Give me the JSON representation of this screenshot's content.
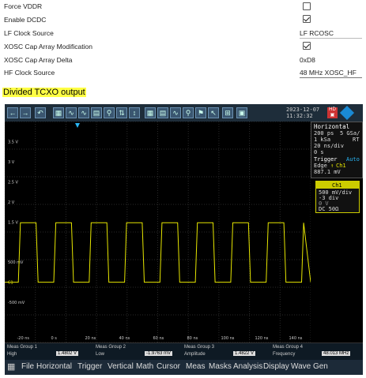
{
  "settings": {
    "force_vddr": {
      "label": "Force VDDR",
      "checked": false
    },
    "enable_dcdc": {
      "label": "Enable DCDC",
      "checked": true
    },
    "lf_clock": {
      "label": "LF Clock Source",
      "value": "LF RCOSC"
    },
    "xosc_cap_mod": {
      "label": "XOSC Cap Array Modification",
      "checked": true
    },
    "xosc_cap_delta": {
      "label": "XOSC Cap Array Delta",
      "value": "0xD8"
    },
    "hf_clock": {
      "label": "HF Clock Source",
      "value": "48 MHz XOSC_HF"
    }
  },
  "heading": "Divided TCXO output",
  "scope": {
    "datetime": {
      "date": "2023-12-07",
      "time": "11:32:32"
    },
    "horizontal": {
      "title": "Horizontal",
      "line1": "200 ps",
      "rate": "5 GSa/",
      "line2": "1 kSa",
      "rt": "RT",
      "div": "20 ns/div",
      "offset": "0 s"
    },
    "trigger": {
      "title": "Trigger",
      "mode": "Auto",
      "edge": "Edge",
      "src": "Ch1",
      "level": "887.1 mV"
    },
    "ch1": {
      "title": "Ch1",
      "scale": "500 mV/div",
      "offset": "-3 div",
      "volt": "0 V",
      "coupling": "DC 50Ω"
    },
    "y_labels": [
      "3.5 V",
      "3 V",
      "2.5 V",
      "2 V",
      "1.5 V",
      "500 mV",
      "C1",
      "-500 mV"
    ],
    "x_labels": [
      "-20 ns",
      "0 s",
      "20 ns",
      "40 ns",
      "60 ns",
      "80 ns",
      "100 ns",
      "120 ns",
      "140 ns"
    ],
    "meas": {
      "groups": [
        "Meas Group 1",
        "Meas Group 2",
        "Meas Group 3",
        "Meas Group 4"
      ],
      "names": [
        "High",
        "Low",
        "Amplitude",
        "Frequency"
      ],
      "values": [
        "1.4802 V",
        "-1.9763 mV",
        "1.4822 V",
        "48.013 MHz"
      ]
    },
    "menu": [
      "File",
      "Horizontal",
      "Trigger",
      "Vertical",
      "Math",
      "Cursor",
      "Meas",
      "Masks",
      "Analysis",
      "Display",
      "Wave Gen"
    ]
  },
  "chart_data": {
    "type": "line",
    "title": "",
    "xlabel": "",
    "ylabel": "",
    "xlim_ns": [
      -30,
      150
    ],
    "ylim_v": [
      -1.5,
      4.0
    ],
    "waveform": {
      "high_v": 1.48,
      "low_v": 0.0,
      "frequency_mhz": 48.013,
      "period_ns": 20.83,
      "first_rising_ns": -22.0
    },
    "grid": true
  },
  "colors": {
    "trace": "#e6e600",
    "accent": "#ffff44",
    "scope_bg": "#000000",
    "grid": "#333333"
  }
}
